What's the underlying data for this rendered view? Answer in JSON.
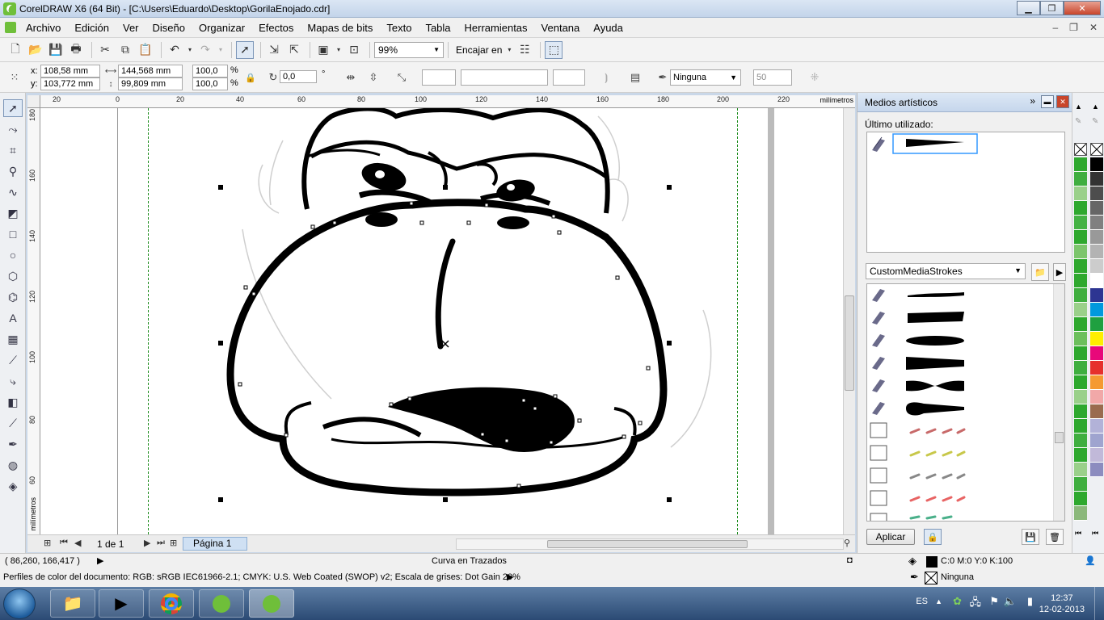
{
  "window": {
    "title": "CorelDRAW X6 (64 Bit) - [C:\\Users\\Eduardo\\Desktop\\GorilaEnojado.cdr]"
  },
  "menu": [
    "Archivo",
    "Edición",
    "Ver",
    "Diseño",
    "Organizar",
    "Efectos",
    "Mapas de bits",
    "Texto",
    "Tabla",
    "Herramientas",
    "Ventana",
    "Ayuda"
  ],
  "toolbar": {
    "zoom": "99%",
    "snap": "Encajar en"
  },
  "property_bar": {
    "x": "108,58 mm",
    "y": "103,772 mm",
    "width": "144,568 mm",
    "height": "99,809 mm",
    "scale_x": "100,0",
    "scale_y": "100,0",
    "percent": "%",
    "rotation": "0,0",
    "degree": "°",
    "outline": "Ninguna",
    "size": "50",
    "x_label": "x:",
    "y_label": "y:"
  },
  "ruler": {
    "top": [
      "20",
      "0",
      "20",
      "40",
      "60",
      "80",
      "100",
      "120",
      "140",
      "160",
      "180",
      "200",
      "220"
    ],
    "left": [
      "180",
      "160",
      "140",
      "120",
      "100",
      "80",
      "60"
    ],
    "unit": "milímetros"
  },
  "page_nav": {
    "count": "1 de 1",
    "tab": "Página 1"
  },
  "docker": {
    "title": "Medios artísticos",
    "recent_label": "Último utilizado:",
    "library": "CustomMediaStrokes",
    "apply": "Aplicar"
  },
  "status": {
    "coords": "( 86,260, 166,417 )",
    "object": "Curva en Trazados",
    "fill": "C:0 M:0 Y:0 K:100",
    "outline": "Ninguna",
    "profiles": "Perfiles de color del documento: RGB: sRGB IEC61966-2.1; CMYK: U.S. Web Coated (SWOP) v2; Escala de grises: Dot Gain 20%"
  },
  "taskbar": {
    "lang": "ES",
    "time": "12:37",
    "date": "12-02-2013"
  },
  "palette": {
    "left": [
      "#2ea82e",
      "#3fae3f",
      "#9ad08a",
      "#2ea82e",
      "#44b244",
      "#2ea82e",
      "#7cc56c",
      "#2ea82e",
      "#2ea82e",
      "#3fae3f",
      "#9ad08a",
      "#2ea82e",
      "#6cbf5c",
      "#2ea82e",
      "#3fae3f",
      "#2ea82e",
      "#9ad08a",
      "#2ea82e",
      "#2ea82e",
      "#3fae3f",
      "#2ea82e",
      "#9ad08a",
      "#3fae3f",
      "#2ea82e",
      "#8bb87b"
    ],
    "right": [
      "#000000",
      "#333333",
      "#4d4d4d",
      "#666666",
      "#808080",
      "#999999",
      "#b3b3b3",
      "#cccccc",
      "#ffffff",
      "#2d3592",
      "#0099dd",
      "#1fa040",
      "#ffee00",
      "#e8087a",
      "#e6302c",
      "#f59a32",
      "#f1a8a8",
      "#9a6b4e",
      "#b2b2d8",
      "#9fa4cf",
      "#c1b9d9",
      "#8c8cbf"
    ]
  }
}
